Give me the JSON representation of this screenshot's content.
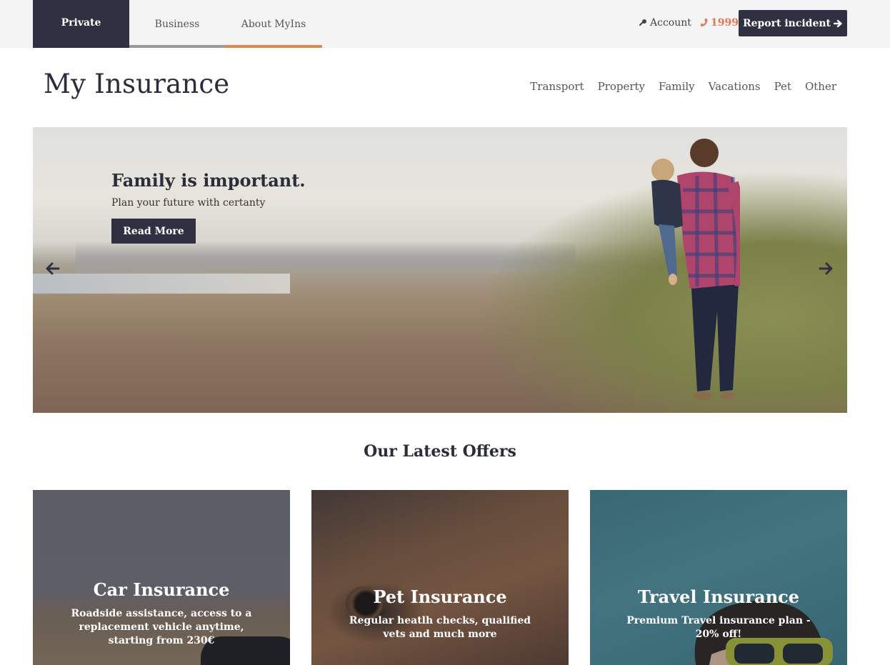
{
  "topbar": {
    "segments": [
      {
        "label": "Private",
        "active": true
      },
      {
        "label": "Business"
      },
      {
        "label": "About MyIns"
      }
    ],
    "account_label": "Account",
    "phone_label": "1999",
    "report_label": "Report incident",
    "icons": {
      "account": "key-icon",
      "phone": "phone-icon",
      "report": "arrow-right-icon"
    },
    "colors": {
      "dark": "#2f3142",
      "accent": "#e0875a"
    }
  },
  "header": {
    "brand": "My Insurance",
    "nav": [
      "Transport",
      "Property",
      "Family",
      "Vacations",
      "Pet",
      "Other"
    ]
  },
  "hero": {
    "title": "Family is important.",
    "subtitle": "Plan your future with certanty",
    "button_label": "Read More",
    "prev_icon": "arrow-left-icon",
    "next_icon": "arrow-right-icon"
  },
  "offers": {
    "title": "Our Latest Offers",
    "cards": [
      {
        "title": "Car Insurance",
        "text": "Roadside assistance, access to a replacement vehicle anytime, starting from 230€"
      },
      {
        "title": "Pet Insurance",
        "text": "Regular heatlh checks, qualified vets and much more"
      },
      {
        "title": "Travel Insurance",
        "text": "Premium Travel insurance plan - 20% off!"
      }
    ]
  }
}
